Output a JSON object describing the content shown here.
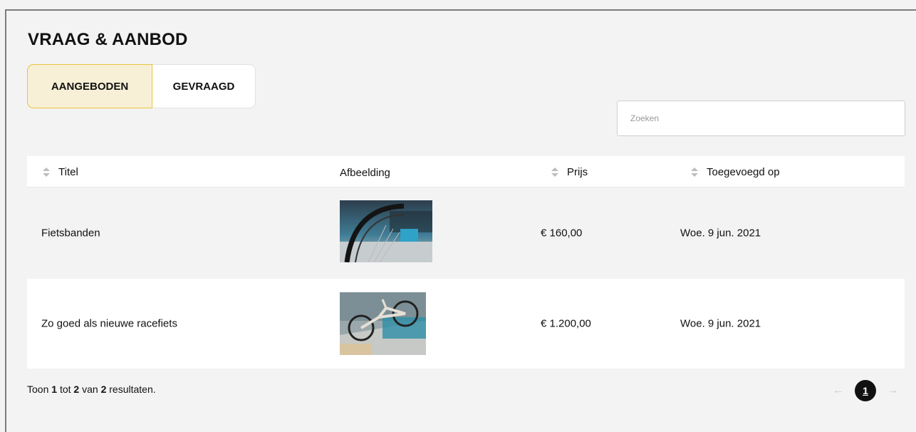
{
  "page": {
    "title": "VRAAG & AANBOD"
  },
  "tabs": [
    {
      "label": "AANGEBODEN",
      "active": true
    },
    {
      "label": "GEVRAAGD",
      "active": false
    }
  ],
  "search": {
    "placeholder": "Zoeken",
    "value": ""
  },
  "table": {
    "columns": [
      "Titel",
      "Afbeelding",
      "Prijs",
      "Toegevoegd op"
    ],
    "rows": [
      {
        "title": "Fietsbanden",
        "image": "bicycle-tire-photo",
        "price": "€ 160,00",
        "added": "Woe. 9 jun. 2021"
      },
      {
        "title": "Zo goed als nieuwe racefiets",
        "image": "road-bike-photo",
        "price": "€ 1.200,00",
        "added": "Woe. 9 jun. 2021"
      }
    ]
  },
  "footer": {
    "prefix": "Toon",
    "from": "1",
    "mid1": "tot",
    "to": "2",
    "mid2": "van",
    "total": "2",
    "suffix": "resultaten."
  },
  "pagination": {
    "prev": "←",
    "current": "1",
    "next": "→"
  },
  "colors": {
    "accent": "#e8c53c",
    "active_tab_bg": "#f8f0d6",
    "page_bg": "#f3f3f3"
  }
}
